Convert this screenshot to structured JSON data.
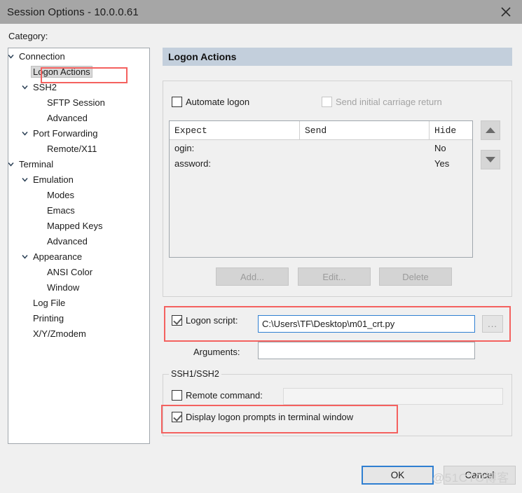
{
  "window": {
    "title": "Session Options - 10.0.0.61",
    "close_icon": "close-icon"
  },
  "category": {
    "label": "Category:",
    "tree": [
      {
        "label": "Connection",
        "depth": 0,
        "expandable": true,
        "selected": false
      },
      {
        "label": "Logon Actions",
        "depth": 1,
        "expandable": false,
        "selected": true
      },
      {
        "label": "SSH2",
        "depth": 1,
        "expandable": true,
        "selected": false
      },
      {
        "label": "SFTP Session",
        "depth": 2,
        "expandable": false,
        "selected": false
      },
      {
        "label": "Advanced",
        "depth": 2,
        "expandable": false,
        "selected": false
      },
      {
        "label": "Port Forwarding",
        "depth": 1,
        "expandable": true,
        "selected": false
      },
      {
        "label": "Remote/X11",
        "depth": 2,
        "expandable": false,
        "selected": false
      },
      {
        "label": "Terminal",
        "depth": 0,
        "expandable": true,
        "selected": false
      },
      {
        "label": "Emulation",
        "depth": 1,
        "expandable": true,
        "selected": false
      },
      {
        "label": "Modes",
        "depth": 2,
        "expandable": false,
        "selected": false
      },
      {
        "label": "Emacs",
        "depth": 2,
        "expandable": false,
        "selected": false
      },
      {
        "label": "Mapped Keys",
        "depth": 2,
        "expandable": false,
        "selected": false
      },
      {
        "label": "Advanced",
        "depth": 2,
        "expandable": false,
        "selected": false
      },
      {
        "label": "Appearance",
        "depth": 1,
        "expandable": true,
        "selected": false
      },
      {
        "label": "ANSI Color",
        "depth": 2,
        "expandable": false,
        "selected": false
      },
      {
        "label": "Window",
        "depth": 2,
        "expandable": false,
        "selected": false
      },
      {
        "label": "Log File",
        "depth": 1,
        "expandable": false,
        "selected": false
      },
      {
        "label": "Printing",
        "depth": 1,
        "expandable": false,
        "selected": false
      },
      {
        "label": "X/Y/Zmodem",
        "depth": 1,
        "expandable": false,
        "selected": false
      }
    ]
  },
  "pane": {
    "header": "Logon Actions",
    "automate_logon": {
      "label": "Automate logon",
      "checked": false,
      "enabled": true
    },
    "send_initial_cr": {
      "label": "Send initial carriage return",
      "checked": false,
      "enabled": false
    },
    "table": {
      "columns": [
        "Expect",
        "Send",
        "Hide"
      ],
      "rows": [
        {
          "expect": "ogin:",
          "send": "",
          "hide": "No"
        },
        {
          "expect": "assword:",
          "send": "",
          "hide": "Yes"
        }
      ]
    },
    "move_up_icon": "arrow-up-icon",
    "move_down_icon": "arrow-down-icon",
    "buttons": {
      "add": "Add...",
      "edit": "Edit...",
      "delete": "Delete"
    },
    "logon_script": {
      "label": "Logon script:",
      "checked": true,
      "value": "C:\\Users\\TF\\Desktop\\m01_crt.py",
      "browse_label": "..."
    },
    "arguments": {
      "label": "Arguments:",
      "value": ""
    },
    "ssh_group": {
      "title": "SSH1/SSH2",
      "remote_command": {
        "label": "Remote command:",
        "checked": false,
        "value": ""
      },
      "display_prompts": {
        "label": "Display logon prompts in terminal window",
        "checked": true
      }
    }
  },
  "footer": {
    "ok": "OK",
    "cancel": "Cancel"
  },
  "watermark": "@51CTO博客",
  "colors": {
    "titlebar": "#a6a6a6",
    "pane_header": "#c3cfdc",
    "annotation": "#f4615f",
    "focus": "#2f7fd1",
    "dialog": "#f0f0f0"
  }
}
